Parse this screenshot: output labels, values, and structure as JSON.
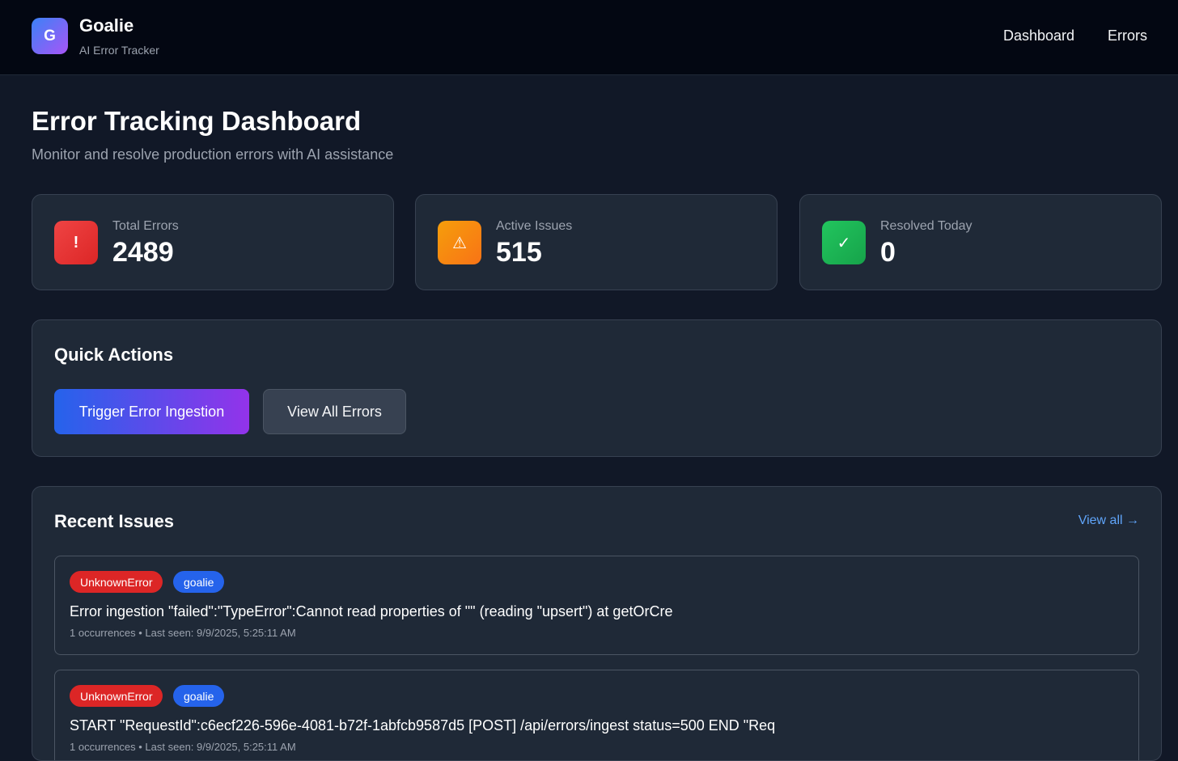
{
  "header": {
    "logo_letter": "G",
    "brand_name": "Goalie",
    "brand_subtitle": "AI Error Tracker",
    "nav": [
      {
        "label": "Dashboard"
      },
      {
        "label": "Errors"
      }
    ]
  },
  "page": {
    "title": "Error Tracking Dashboard",
    "subtitle": "Monitor and resolve production errors with AI assistance"
  },
  "stats": [
    {
      "label": "Total Errors",
      "value": "2489",
      "icon": "exclamation-icon",
      "glyph": "!",
      "color": "#ef4444"
    },
    {
      "label": "Active Issues",
      "value": "515",
      "icon": "warning-icon",
      "glyph": "⚠",
      "color": "#f59e0b"
    },
    {
      "label": "Resolved Today",
      "value": "0",
      "icon": "check-icon",
      "glyph": "✓",
      "color": "#22c55e"
    }
  ],
  "quick_actions": {
    "title": "Quick Actions",
    "primary_label": "Trigger Error Ingestion",
    "secondary_label": "View All Errors"
  },
  "recent_issues": {
    "title": "Recent Issues",
    "view_all_label": "View all →",
    "items": [
      {
        "type": "UnknownError",
        "project": "goalie",
        "message": "Error ingestion \"failed\":\"TypeError\":Cannot read properties of \"\" (reading \"upsert\") at getOrCre",
        "meta": "1 occurrences • Last seen: 9/9/2025, 5:25:11 AM"
      },
      {
        "type": "UnknownError",
        "project": "goalie",
        "message": "START \"RequestId\":c6ecf226-596e-4081-b72f-1abfcb9587d5 [POST] /api/errors/ingest status=500 END \"Req",
        "meta": "1 occurrences • Last seen: 9/9/2025, 5:25:11 AM"
      }
    ]
  }
}
